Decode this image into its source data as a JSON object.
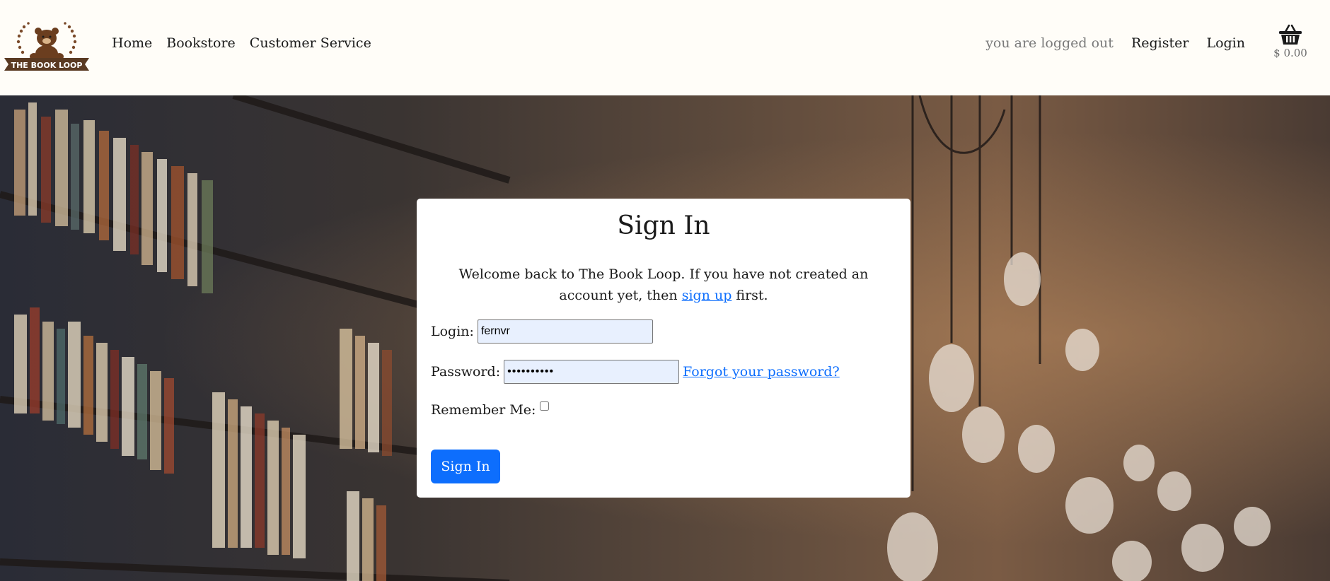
{
  "brand": {
    "logo_text": "THE BOOK LOOP",
    "icon": "bear-logo-icon"
  },
  "nav": {
    "items": [
      {
        "label": "Home"
      },
      {
        "label": "Bookstore"
      },
      {
        "label": "Customer Service"
      }
    ]
  },
  "account": {
    "status": "you are logged out",
    "register_label": "Register",
    "login_label": "Login"
  },
  "cart": {
    "icon": "basket-icon",
    "total": "$ 0.00"
  },
  "signin": {
    "title": "Sign In",
    "welcome_before": "Welcome back to The Book Loop. If you have not created an account yet, then ",
    "signup_link": "sign up",
    "welcome_after": " first.",
    "login_label": "Login:",
    "login_value": "fernvr",
    "password_label": "Password:",
    "password_value": "••••••••••",
    "forgot_link": "Forgot your password?",
    "remember_label": "Remember Me:",
    "remember_checked": false,
    "submit_label": "Sign In"
  },
  "colors": {
    "primary": "#0d6efd",
    "navbar_bg": "#fffdf8",
    "logo_brown": "#5a3a22"
  }
}
